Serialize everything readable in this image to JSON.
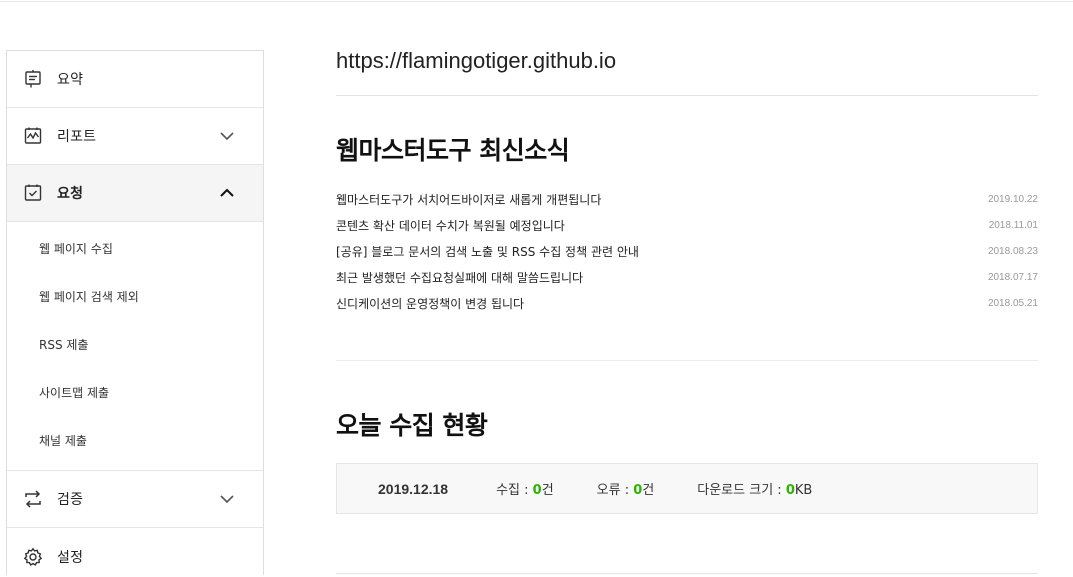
{
  "site": {
    "url": "https://flamingotiger.github.io"
  },
  "sidebar": {
    "items": [
      {
        "label": "요약",
        "icon": "summary-icon"
      },
      {
        "label": "리포트",
        "icon": "report-icon",
        "chevron": "chevron-down-icon"
      },
      {
        "label": "요청",
        "icon": "request-icon",
        "chevron": "chevron-up-icon"
      },
      {
        "label": "검증",
        "icon": "verify-icon",
        "chevron": "chevron-down-icon"
      },
      {
        "label": "설정",
        "icon": "gear-icon"
      }
    ],
    "sub_items": [
      "웹 페이지 수집",
      "웹 페이지 검색 제외",
      "RSS 제출",
      "사이트맵 제출",
      "채널 제출"
    ]
  },
  "news": {
    "title": "웹마스터도구 최신소식",
    "items": [
      {
        "title": "웹마스터도구가 서치어드바이저로 새롭게 개편됩니다",
        "date": "2019.10.22"
      },
      {
        "title": "콘텐츠 확산 데이터 수치가 복원될 예정입니다",
        "date": "2018.11.01"
      },
      {
        "title": "[공유] 블로그 문서의 검색 노출 및 RSS 수집 정책 관련 안내",
        "date": "2018.08.23"
      },
      {
        "title": "최근 발생했던 수집요청실패에 대해 말씀드립니다",
        "date": "2018.07.17"
      },
      {
        "title": "신디케이션의 운영정책이 변경 됩니다",
        "date": "2018.05.21"
      }
    ]
  },
  "today": {
    "title": "오늘 수집 현황",
    "date": "2019.12.18",
    "collect_label": "수집 : ",
    "collect_value": "0",
    "collect_unit": "건",
    "error_label": "오류 : ",
    "error_value": "0",
    "error_unit": "건",
    "download_label": "다운로드 크기 : ",
    "download_value": "0",
    "download_unit": "KB"
  },
  "colors": {
    "accent": "#2db400",
    "active_bg": "#f5f5f5"
  }
}
